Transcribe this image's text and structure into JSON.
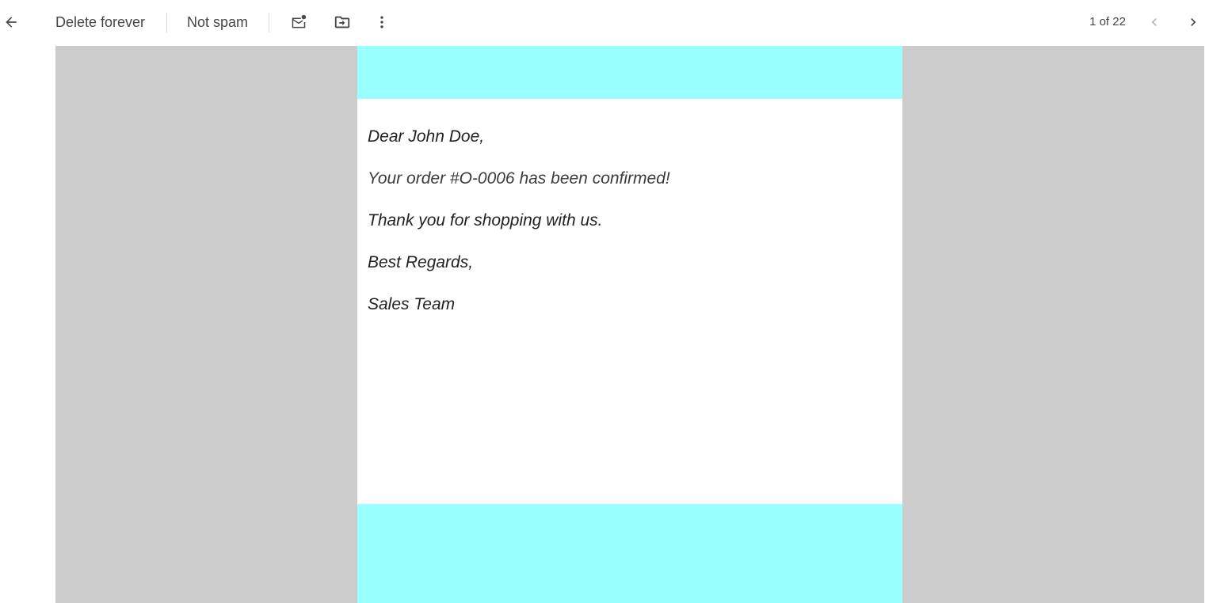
{
  "toolbar": {
    "back_icon": "arrow-left-icon",
    "delete_forever_label": "Delete forever",
    "not_spam_label": "Not spam",
    "mark_unread_icon": "mark-unread-icon",
    "move_to_icon": "move-to-folder-icon",
    "more_icon": "more-vert-icon",
    "pager_text": "1 of 22",
    "prev_icon": "chevron-left-icon",
    "next_icon": "chevron-right-icon"
  },
  "email": {
    "header_color": "#99ffff",
    "footer_color": "#99ffff",
    "lines": [
      "Dear John Doe,",
      "Your order #O-0006 has been confirmed!",
      "Thank you for shopping with us.",
      "Best Regards,",
      "Sales Team"
    ]
  },
  "colors": {
    "backdrop": "#cccccc",
    "accent_band": "#99ffff",
    "toolbar_text": "#444746"
  }
}
